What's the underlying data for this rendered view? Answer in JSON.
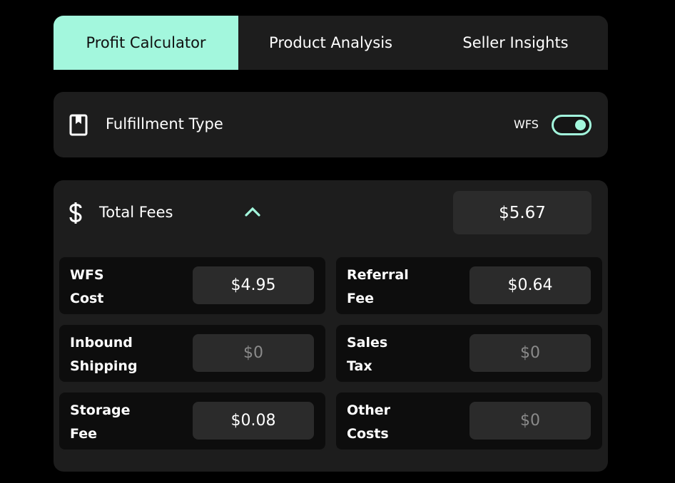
{
  "tabs": [
    {
      "label": "Profit Calculator",
      "active": true
    },
    {
      "label": "Product Analysis",
      "active": false
    },
    {
      "label": "Seller Insights",
      "active": false
    }
  ],
  "fulfillment": {
    "icon": "bookmark-icon",
    "label": "Fulfillment Type",
    "toggle_label": "WFS",
    "toggle_on": true
  },
  "fees": {
    "icon": "dollar-icon",
    "label": "Total Fees",
    "collapse_icon": "chevron-up-icon",
    "total": "$5.67",
    "items": [
      {
        "line1": "WFS",
        "line2": "Cost",
        "value": "$4.95"
      },
      {
        "line1": "Referral",
        "line2": "Fee",
        "value": "$0.64"
      },
      {
        "line1": "Inbound",
        "line2": "Shipping",
        "value": "$0"
      },
      {
        "line1": "Sales",
        "line2": "Tax",
        "value": "$0"
      },
      {
        "line1": "Storage",
        "line2": "Fee",
        "value": "$0.08"
      },
      {
        "line1": "Other",
        "line2": "Costs",
        "value": "$0"
      }
    ]
  },
  "colors": {
    "accent": "#a3f7dd",
    "background": "#000000",
    "card": "#1d1d1d",
    "field": "#2b2b2b",
    "muted_text": "#8a8a8a"
  }
}
